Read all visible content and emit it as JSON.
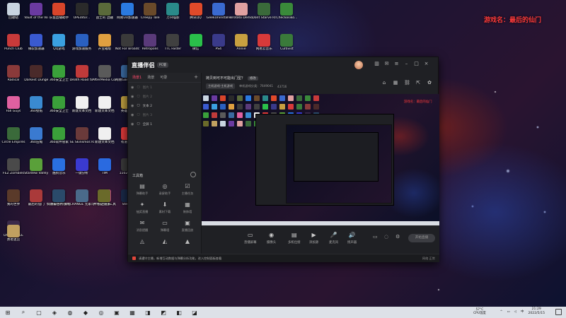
{
  "overlay": {
    "title": "游戏名：最后的仙门"
  },
  "desktop_icons": [
    {
      "label": "回收站",
      "color": "#c8d4e0"
    },
    {
      "label": "Vault of the Void 迷宫",
      "color": "#6a3aa0"
    },
    {
      "label": "乐鱼直播助手",
      "color": "#d8452a"
    },
    {
      "label": "UPEditor...",
      "color": "#2a2a2a"
    },
    {
      "label": "战士的 边疆",
      "color": "#5a6a3a"
    },
    {
      "label": "网易UU加速器",
      "color": "#2a7ae0"
    },
    {
      "label": "Creepy Tale",
      "color": "#6a4a2a"
    },
    {
      "label": "万兴喵影",
      "color": "#2a8a8a"
    },
    {
      "label": "腾讯QQ",
      "color": "#e04a2a"
    },
    {
      "label": "GeekUninstaller",
      "color": "#3a6ad0"
    },
    {
      "label": "Brotato Demo",
      "color": "#e0a0a0"
    },
    {
      "label": "Dont Starve Rake...",
      "color": "#3a6a3a"
    },
    {
      "label": "Checkosiko...",
      "color": "#3a8a3a"
    },
    {
      "label": "Punch Club",
      "color": "#c83a3a"
    },
    {
      "label": "微软加速器",
      "color": "#3a5ad0"
    },
    {
      "label": "QQ游戏",
      "color": "#3aa0e0"
    },
    {
      "label": "游戏加速服务",
      "color": "#2a60c0"
    },
    {
      "label": "开宝箱版",
      "color": "#e0a040"
    },
    {
      "label": "Not For Broadcast",
      "color": "#3a3a3a"
    },
    {
      "label": "Retropolis",
      "color": "#5a3a7a"
    },
    {
      "label": "TTL Faster",
      "color": "#404040"
    },
    {
      "label": "微信",
      "color": "#2ac04a"
    },
    {
      "label": "PS4",
      "color": "#3a3a8a"
    },
    {
      "label": "Annie",
      "color": "#c8a040"
    },
    {
      "label": "网易云音乐",
      "color": "#d83a3a"
    },
    {
      "label": "Cultivist",
      "color": "#3a7a3a"
    },
    {
      "label": "Radical",
      "color": "#8a3a3a"
    },
    {
      "label": "Darkest Dungeon",
      "color": "#4a2a2a"
    },
    {
      "label": "360安全卫士",
      "color": "#3aa03a"
    },
    {
      "label": "Death Road to Canada",
      "color": "#c03a3a"
    },
    {
      "label": "AfterMedia Control",
      "color": "#5a5a5a"
    },
    {
      "label": "网易GameRequirement",
      "color": "#3a6aa0"
    },
    {
      "label": "Fall Guys",
      "color": "#e060a0"
    },
    {
      "label": "360壁纸",
      "color": "#3a8ad0"
    },
    {
      "label": "360安全卫士",
      "color": "#3aa03a"
    },
    {
      "label": "新建文本文档",
      "color": "#f0f0f0"
    },
    {
      "label": "新建文本文档",
      "color": "#f0f0f0"
    },
    {
      "label": "英雄联盟",
      "color": "#c0a040"
    },
    {
      "label": "Circle Empires",
      "color": "#3a6a3a"
    },
    {
      "label": "360压缩",
      "color": "#3a7ad0"
    },
    {
      "label": "360软件管家",
      "color": "#3aa03a"
    },
    {
      "label": "SE Skinsmos Raiders",
      "color": "#6a3a3a"
    },
    {
      "label": "新建文本文档",
      "color": "#f0f0f0"
    },
    {
      "label": "有道翻译",
      "color": "#e03a3a"
    },
    {
      "label": "FEZ Zombies",
      "color": "#4a4a4a"
    },
    {
      "label": "Stardew Valley",
      "color": "#5aa03a"
    },
    {
      "label": "酷狗音乐",
      "color": "#2a70e0"
    },
    {
      "label": "一键分析",
      "color": "#3a3ad0"
    },
    {
      "label": "TIM",
      "color": "#2a6ae0"
    },
    {
      "label": "1102_270",
      "color": "#3a3a3a"
    },
    {
      "label": "我的世界",
      "color": "#5a3a2a"
    },
    {
      "label": "最后的仙门",
      "color": "#aa3a3a"
    },
    {
      "label": "CHANGE 无家可归",
      "color": "#4a6a8a"
    },
    {
      "label": "CHANGE 无家可归",
      "color": "#4a6a8a"
    },
    {
      "label": "神经猫挑战工具",
      "color": "#e04aa0"
    },
    {
      "label": "Steam",
      "color": "#1a2a4a"
    },
    {
      "label": "DYSMANTLE",
      "color": "#3a2a4a"
    },
    {
      "label": "饥饿鲨世界 果物挂",
      "color": "#2a4a6a"
    },
    {
      "label": "织之道系",
      "color": "#6a6a2a"
    },
    {
      "label": "勇者迷宫",
      "color": "#c0a060"
    }
  ],
  "app": {
    "logo": "直播伴侣",
    "version": "PC版",
    "tabs": [
      "场景1",
      "场景",
      "可录"
    ],
    "sources": [
      {
        "label": "图片 1",
        "hidden": true
      },
      {
        "label": "图片 2",
        "hidden": true
      },
      {
        "label": "文本 2",
        "hidden": false
      },
      {
        "label": "图片 3",
        "hidden": true
      },
      {
        "label": "全屏 1",
        "hidden": false
      }
    ],
    "tool_header": "工具箱",
    "tools": [
      {
        "label": "弹幕助手",
        "icon": "▤"
      },
      {
        "label": "录屏助手",
        "icon": "◎"
      },
      {
        "label": "主播任务",
        "icon": "☑"
      },
      {
        "label": "抽奖直播",
        "icon": "✦"
      },
      {
        "label": "素材下载",
        "icon": "⬇"
      },
      {
        "label": "装饰墙",
        "icon": "▦"
      },
      {
        "label": "消息提醒",
        "icon": "✉"
      },
      {
        "label": "弹幕墙",
        "icon": "▭"
      },
      {
        "label": "直播回放",
        "icon": "▣"
      },
      {
        "label": "",
        "icon": "◬"
      },
      {
        "label": "",
        "icon": "◭"
      },
      {
        "label": "",
        "icon": "▲"
      }
    ],
    "room_title": "拷贝到可不可能出门型？",
    "room_edit": "修改",
    "room_meta": [
      "主机游戏-主机游戏",
      "单机游戏分类：7649041",
      "43716"
    ],
    "preview_red_text": "游戏名：最后的仙门",
    "controls": [
      {
        "label": "直播屏幕",
        "icon": "▭"
      },
      {
        "label": "摄像头",
        "icon": "◉"
      },
      {
        "label": "多机位接",
        "icon": "▤"
      },
      {
        "label": "添加源",
        "icon": "▶"
      },
      {
        "label": "麦克风",
        "icon": "🎤"
      },
      {
        "label": "扬声器",
        "icon": "🔊"
      }
    ],
    "start_label": "开始直播",
    "status_text": "请遵守主播，新增互动数据与弹幕分析功能，进入控制面板查看",
    "status_right": "网络 正常"
  },
  "taskbar": {
    "icons": [
      "⊞",
      "⌕",
      "▢",
      "◈",
      "◍",
      "◆",
      "◎",
      "▣",
      "▦",
      "◨",
      "◩",
      "◧",
      "◪"
    ],
    "temp": "57°C",
    "temp_label": "CPU温度",
    "time": "21:29",
    "date": "2022/5/15"
  }
}
